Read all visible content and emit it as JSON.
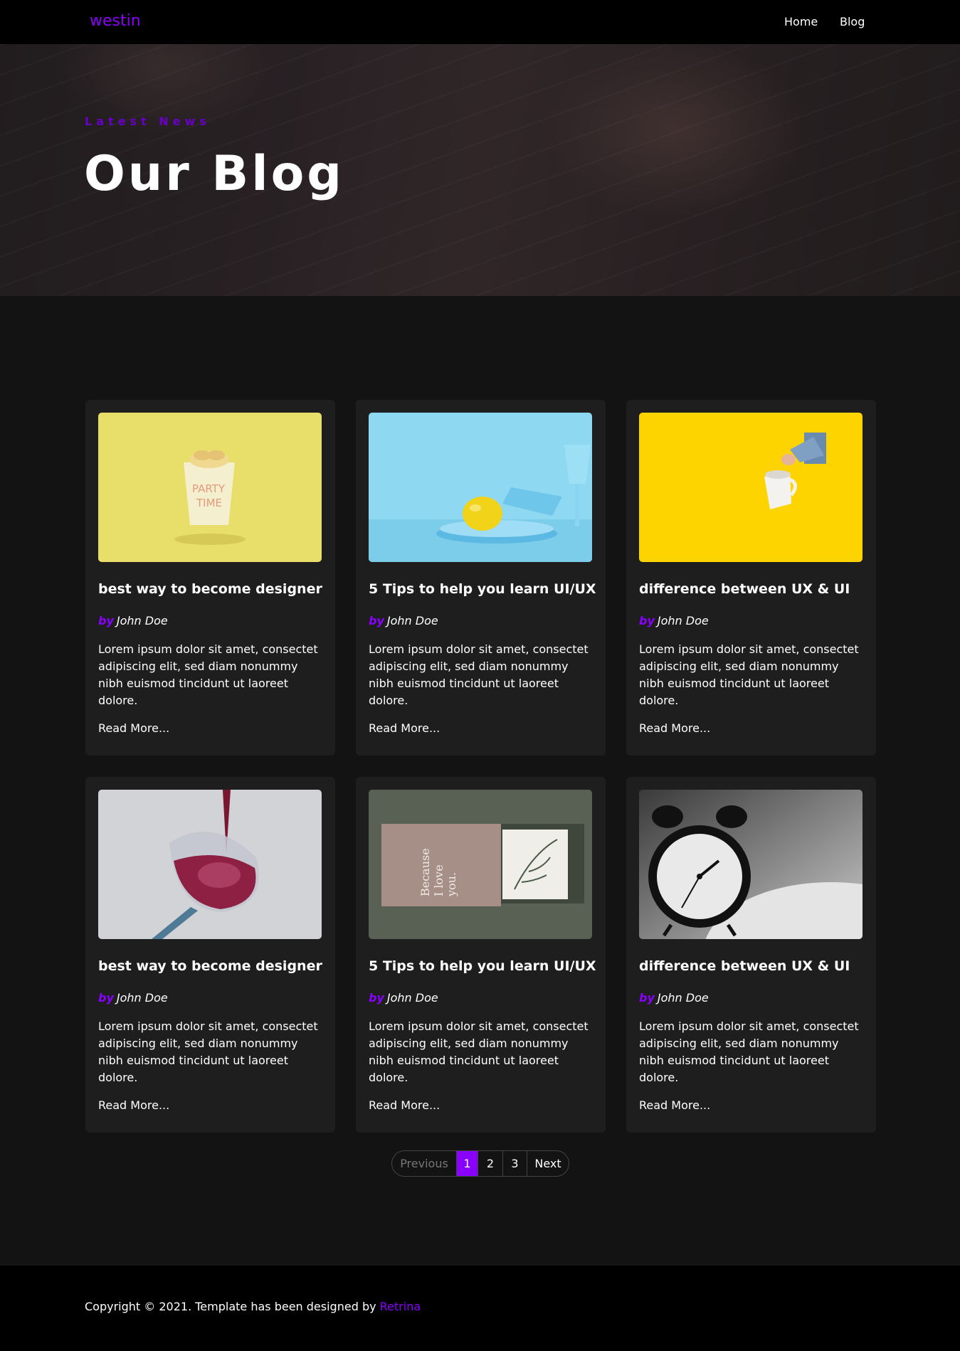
{
  "nav": {
    "brand": "westin",
    "links": [
      "Home",
      "Blog"
    ]
  },
  "hero": {
    "subtitle": "Latest News",
    "title": "Our Blog"
  },
  "posts": [
    {
      "title": "best way to become designer",
      "by": "by",
      "author": "John Doe",
      "excerpt": "Lorem ipsum dolor sit amet, consectet adipiscing elit, sed diam nonummy nibh euismod tincidunt ut laoreet dolore.",
      "link": "Read More..."
    },
    {
      "title": "5 Tips to help you learn UI/UX",
      "by": "by",
      "author": "John Doe",
      "excerpt": "Lorem ipsum dolor sit amet, consectet adipiscing elit, sed diam nonummy nibh euismod tincidunt ut laoreet dolore.",
      "link": "Read More..."
    },
    {
      "title": "difference between UX & UI",
      "by": "by",
      "author": "John Doe",
      "excerpt": "Lorem ipsum dolor sit amet, consectet adipiscing elit, sed diam nonummy nibh euismod tincidunt ut laoreet dolore.",
      "link": "Read More..."
    },
    {
      "title": "best way to become designer",
      "by": "by",
      "author": "John Doe",
      "excerpt": "Lorem ipsum dolor sit amet, consectet adipiscing elit, sed diam nonummy nibh euismod tincidunt ut laoreet dolore.",
      "link": "Read More..."
    },
    {
      "title": "5 Tips to help you learn UI/UX",
      "by": "by",
      "author": "John Doe",
      "excerpt": "Lorem ipsum dolor sit amet, consectet adipiscing elit, sed diam nonummy nibh euismod tincidunt ut laoreet dolore.",
      "link": "Read More..."
    },
    {
      "title": "difference between UX & UI",
      "by": "by",
      "author": "John Doe",
      "excerpt": "Lorem ipsum dolor sit amet, consectet adipiscing elit, sed diam nonummy nibh euismod tincidunt ut laoreet dolore.",
      "link": "Read More..."
    }
  ],
  "pagination": {
    "previous": "Previous",
    "pages": [
      "1",
      "2",
      "3"
    ],
    "next": "Next",
    "current": "1"
  },
  "footer": {
    "copyright": "Copyright © 2021. Template has been designed by",
    "credit": "Retrina"
  },
  "colors": {
    "accent": "#8a00ff",
    "background": "#131313",
    "card": "#1e1e1e",
    "navbar": "#000000"
  }
}
